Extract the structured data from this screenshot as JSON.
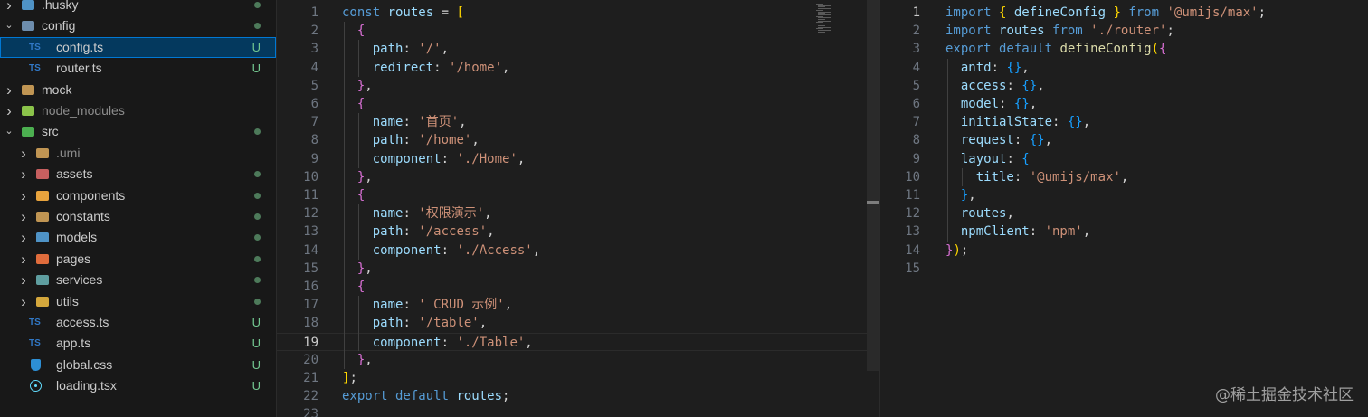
{
  "explorer": {
    "items": [
      {
        "label": ".husky",
        "kind": "folder",
        "depth": 0,
        "expanded": false,
        "icon": "husky-folder-icon",
        "color": "#4f93c6",
        "badge": "dot"
      },
      {
        "label": "config",
        "kind": "folder",
        "depth": 0,
        "expanded": true,
        "icon": "config-folder-icon",
        "color": "#6d8dad",
        "badge": "dot"
      },
      {
        "label": "config.ts",
        "kind": "ts",
        "depth": 1,
        "selected": true,
        "badge": "U"
      },
      {
        "label": "router.ts",
        "kind": "ts",
        "depth": 1,
        "badge": "U"
      },
      {
        "label": "mock",
        "kind": "folder",
        "depth": 0,
        "expanded": false,
        "icon": "mock-folder-icon",
        "color": "#c09553",
        "badge": ""
      },
      {
        "label": "node_modules",
        "kind": "folder",
        "depth": 0,
        "expanded": false,
        "icon": "node-modules-folder-icon",
        "color": "#8bc34a",
        "badge": "",
        "dim": true
      },
      {
        "label": "src",
        "kind": "folder",
        "depth": 0,
        "expanded": true,
        "icon": "src-folder-icon",
        "color": "#4caf50",
        "badge": "dot"
      },
      {
        "label": ".umi",
        "kind": "folder",
        "depth": 1,
        "expanded": false,
        "icon": "umi-folder-icon",
        "color": "#c09553",
        "badge": "",
        "dim": true
      },
      {
        "label": "assets",
        "kind": "folder",
        "depth": 1,
        "expanded": false,
        "icon": "assets-folder-icon",
        "color": "#c65f5f",
        "badge": "dot"
      },
      {
        "label": "components",
        "kind": "folder",
        "depth": 1,
        "expanded": false,
        "icon": "components-folder-icon",
        "color": "#e8a33d",
        "badge": "dot"
      },
      {
        "label": "constants",
        "kind": "folder",
        "depth": 1,
        "expanded": false,
        "icon": "constants-folder-icon",
        "color": "#c09553",
        "badge": "dot"
      },
      {
        "label": "models",
        "kind": "folder",
        "depth": 1,
        "expanded": false,
        "icon": "models-folder-icon",
        "color": "#4f93c6",
        "badge": "dot"
      },
      {
        "label": "pages",
        "kind": "folder",
        "depth": 1,
        "expanded": false,
        "icon": "pages-folder-icon",
        "color": "#e06c3c",
        "badge": "dot"
      },
      {
        "label": "services",
        "kind": "folder",
        "depth": 1,
        "expanded": false,
        "icon": "services-folder-icon",
        "color": "#5f9ea0",
        "badge": "dot"
      },
      {
        "label": "utils",
        "kind": "folder",
        "depth": 1,
        "expanded": false,
        "icon": "utils-folder-icon",
        "color": "#d4a73c",
        "badge": "dot"
      },
      {
        "label": "access.ts",
        "kind": "ts",
        "depth": 1,
        "badge": "U"
      },
      {
        "label": "app.ts",
        "kind": "ts",
        "depth": 1,
        "badge": "U"
      },
      {
        "label": "global.css",
        "kind": "css",
        "depth": 1,
        "badge": "U"
      },
      {
        "label": "loading.tsx",
        "kind": "tsx",
        "depth": 1,
        "badge": "U"
      }
    ],
    "ts_label": "TS"
  },
  "editor_left": {
    "active_line": 19,
    "lines": [
      [
        [
          "kw",
          "const "
        ],
        [
          "v",
          "routes"
        ],
        [
          "p",
          " = "
        ],
        [
          "b1",
          "["
        ]
      ],
      [
        [
          "p",
          "  "
        ],
        [
          "b2",
          "{"
        ]
      ],
      [
        [
          "p",
          "    "
        ],
        [
          "v",
          "path"
        ],
        [
          "p",
          ": "
        ],
        [
          "s",
          "'/'"
        ],
        [
          "p",
          ","
        ]
      ],
      [
        [
          "p",
          "    "
        ],
        [
          "v",
          "redirect"
        ],
        [
          "p",
          ": "
        ],
        [
          "s",
          "'/home'"
        ],
        [
          "p",
          ","
        ]
      ],
      [
        [
          "p",
          "  "
        ],
        [
          "b2",
          "}"
        ],
        [
          "p",
          ","
        ]
      ],
      [
        [
          "p",
          "  "
        ],
        [
          "b2",
          "{"
        ]
      ],
      [
        [
          "p",
          "    "
        ],
        [
          "v",
          "name"
        ],
        [
          "p",
          ": "
        ],
        [
          "s",
          "'首页'"
        ],
        [
          "p",
          ","
        ]
      ],
      [
        [
          "p",
          "    "
        ],
        [
          "v",
          "path"
        ],
        [
          "p",
          ": "
        ],
        [
          "s",
          "'/home'"
        ],
        [
          "p",
          ","
        ]
      ],
      [
        [
          "p",
          "    "
        ],
        [
          "v",
          "component"
        ],
        [
          "p",
          ": "
        ],
        [
          "s",
          "'./Home'"
        ],
        [
          "p",
          ","
        ]
      ],
      [
        [
          "p",
          "  "
        ],
        [
          "b2",
          "}"
        ],
        [
          "p",
          ","
        ]
      ],
      [
        [
          "p",
          "  "
        ],
        [
          "b2",
          "{"
        ]
      ],
      [
        [
          "p",
          "    "
        ],
        [
          "v",
          "name"
        ],
        [
          "p",
          ": "
        ],
        [
          "s",
          "'权限演示'"
        ],
        [
          "p",
          ","
        ]
      ],
      [
        [
          "p",
          "    "
        ],
        [
          "v",
          "path"
        ],
        [
          "p",
          ": "
        ],
        [
          "s",
          "'/access'"
        ],
        [
          "p",
          ","
        ]
      ],
      [
        [
          "p",
          "    "
        ],
        [
          "v",
          "component"
        ],
        [
          "p",
          ": "
        ],
        [
          "s",
          "'./Access'"
        ],
        [
          "p",
          ","
        ]
      ],
      [
        [
          "p",
          "  "
        ],
        [
          "b2",
          "}"
        ],
        [
          "p",
          ","
        ]
      ],
      [
        [
          "p",
          "  "
        ],
        [
          "b2",
          "{"
        ]
      ],
      [
        [
          "p",
          "    "
        ],
        [
          "v",
          "name"
        ],
        [
          "p",
          ": "
        ],
        [
          "s",
          "' CRUD 示例'"
        ],
        [
          "p",
          ","
        ]
      ],
      [
        [
          "p",
          "    "
        ],
        [
          "v",
          "path"
        ],
        [
          "p",
          ": "
        ],
        [
          "s",
          "'/table'"
        ],
        [
          "p",
          ","
        ]
      ],
      [
        [
          "p",
          "    "
        ],
        [
          "v",
          "component"
        ],
        [
          "p",
          ": "
        ],
        [
          "s",
          "'./Table'"
        ],
        [
          "p",
          ","
        ]
      ],
      [
        [
          "p",
          "  "
        ],
        [
          "b2",
          "}"
        ],
        [
          "p",
          ","
        ]
      ],
      [
        [
          "b1",
          "]"
        ],
        [
          "p",
          ";"
        ]
      ],
      [
        [
          "kw",
          "export default "
        ],
        [
          "v",
          "routes"
        ],
        [
          "p",
          ";"
        ]
      ],
      [
        [
          "p",
          ""
        ]
      ]
    ]
  },
  "editor_right": {
    "active_line": 1,
    "lines": [
      [
        [
          "kw",
          "import "
        ],
        [
          "b1",
          "{ "
        ],
        [
          "v",
          "defineConfig"
        ],
        [
          "b1",
          " }"
        ],
        [
          "kw",
          " from "
        ],
        [
          "s",
          "'@umijs/max'"
        ],
        [
          "p",
          ";"
        ]
      ],
      [
        [
          "kw",
          "import "
        ],
        [
          "v",
          "routes"
        ],
        [
          "kw",
          " from "
        ],
        [
          "s",
          "'./router'"
        ],
        [
          "p",
          ";"
        ]
      ],
      [
        [
          "kw",
          "export default "
        ],
        [
          "fn",
          "defineConfig"
        ],
        [
          "b1",
          "("
        ],
        [
          "b2",
          "{"
        ]
      ],
      [
        [
          "p",
          "  "
        ],
        [
          "v",
          "antd"
        ],
        [
          "p",
          ": "
        ],
        [
          "b3",
          "{}"
        ],
        [
          "p",
          ","
        ]
      ],
      [
        [
          "p",
          "  "
        ],
        [
          "v",
          "access"
        ],
        [
          "p",
          ": "
        ],
        [
          "b3",
          "{}"
        ],
        [
          "p",
          ","
        ]
      ],
      [
        [
          "p",
          "  "
        ],
        [
          "v",
          "model"
        ],
        [
          "p",
          ": "
        ],
        [
          "b3",
          "{}"
        ],
        [
          "p",
          ","
        ]
      ],
      [
        [
          "p",
          "  "
        ],
        [
          "v",
          "initialState"
        ],
        [
          "p",
          ": "
        ],
        [
          "b3",
          "{}"
        ],
        [
          "p",
          ","
        ]
      ],
      [
        [
          "p",
          "  "
        ],
        [
          "v",
          "request"
        ],
        [
          "p",
          ": "
        ],
        [
          "b3",
          "{}"
        ],
        [
          "p",
          ","
        ]
      ],
      [
        [
          "p",
          "  "
        ],
        [
          "v",
          "layout"
        ],
        [
          "p",
          ": "
        ],
        [
          "b3",
          "{"
        ]
      ],
      [
        [
          "p",
          "    "
        ],
        [
          "v",
          "title"
        ],
        [
          "p",
          ": "
        ],
        [
          "s",
          "'@umijs/max'"
        ],
        [
          "p",
          ","
        ]
      ],
      [
        [
          "p",
          "  "
        ],
        [
          "b3",
          "}"
        ],
        [
          "p",
          ","
        ]
      ],
      [
        [
          "p",
          "  "
        ],
        [
          "v",
          "routes"
        ],
        [
          "p",
          ","
        ]
      ],
      [
        [
          "p",
          "  "
        ],
        [
          "v",
          "npmClient"
        ],
        [
          "p",
          ": "
        ],
        [
          "s",
          "'npm'"
        ],
        [
          "p",
          ","
        ]
      ],
      [
        [
          "b2",
          "}"
        ],
        [
          "b1",
          ")"
        ],
        [
          "p",
          ";"
        ]
      ],
      [
        [
          "p",
          ""
        ]
      ]
    ]
  },
  "watermark": "@稀土掘金技术社区"
}
